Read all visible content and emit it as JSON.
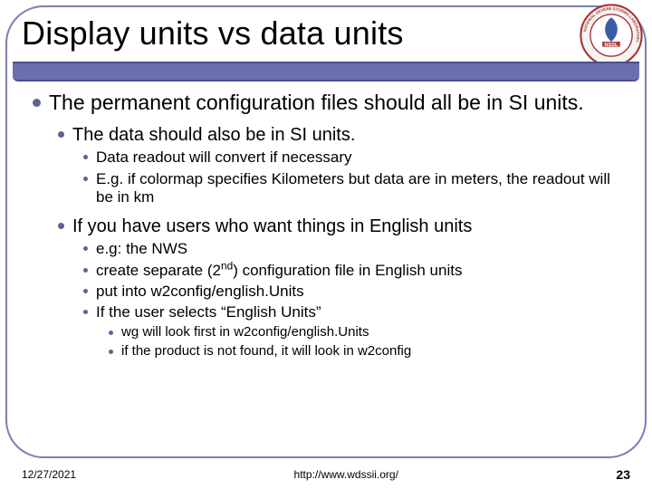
{
  "title": "Display units vs data units",
  "bullets": {
    "l1": "The permanent configuration files should all be in SI units.",
    "l2a": "The data should also be in SI units.",
    "l3a": "Data readout will convert if necessary",
    "l3b": "E.g. if colormap specifies Kilometers but data are in meters, the readout will be in km",
    "l2b": "If you have users who want things in English units",
    "l3c_pre": " e.g: the NWS",
    "l3d_pre": "create separate (2",
    "l3d_sup": "nd",
    "l3d_post": ") configuration file in English units",
    "l3e": "put into w2config/english.Units",
    "l3f": "If the user selects “English Units”",
    "l4a": "wg will look first in w2config/english.Units",
    "l4b": "if the product is not found, it will look in w2config"
  },
  "footer": {
    "date": "12/27/2021",
    "url": "http://www.wdssii.org/",
    "page": "23"
  },
  "badge": {
    "outer_text": "NATIONAL SEVERE STORMS LABORATORY",
    "abbr": "NSSL"
  }
}
